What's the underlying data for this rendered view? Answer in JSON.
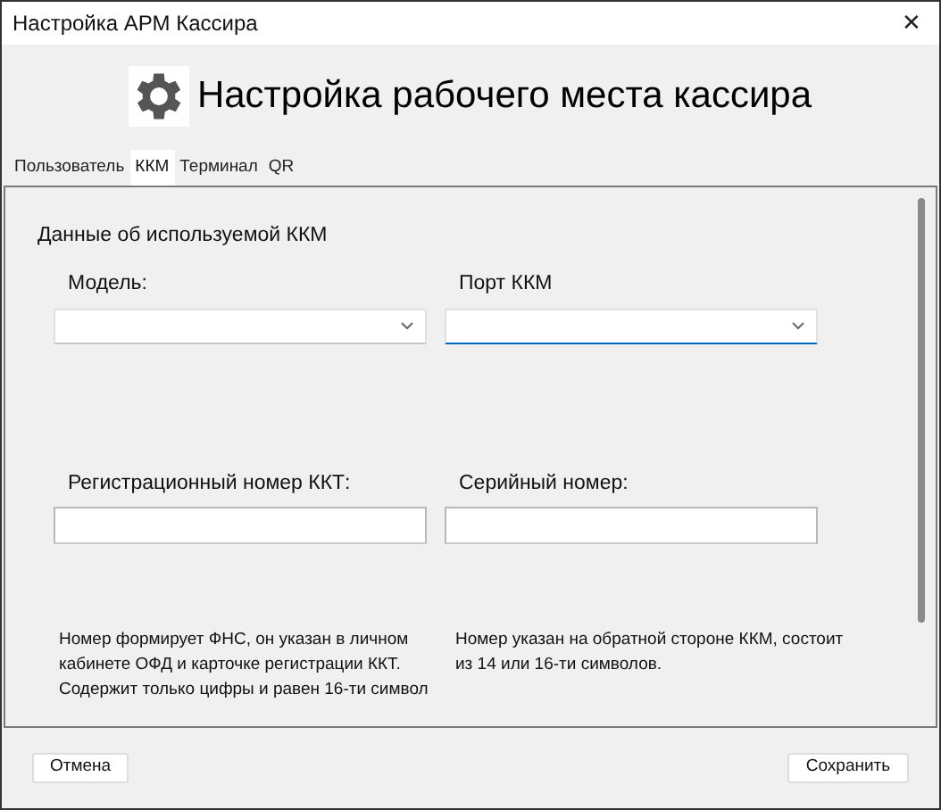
{
  "window": {
    "title": "Настройка АРМ Кассира",
    "close": "✕"
  },
  "header": {
    "title": "Настройка рабочего места кассира"
  },
  "tabs": [
    {
      "label": "Пользователь",
      "selected": false
    },
    {
      "label": "ККМ",
      "selected": true
    },
    {
      "label": "Терминал",
      "selected": false
    },
    {
      "label": "QR",
      "selected": false
    }
  ],
  "section": {
    "title": "Данные об используемой ККМ"
  },
  "fields": [
    {
      "label": "Модель:",
      "kind": "combo",
      "focused": false
    },
    {
      "label": "Порт ККМ",
      "kind": "combo",
      "focused": true
    },
    {
      "label": "Регистрационный номер ККТ:",
      "kind": "text",
      "focused": false,
      "hint": [
        "Номер формирует ФНС, он указан в личном",
        "кабинете ОФД и карточке регистрации ККТ.",
        "Содержит только цифры и равен 16-ти символ"
      ]
    },
    {
      "label": "Серийный номер:",
      "kind": "text",
      "focused": false,
      "hint": [
        "Номер указан на обратной стороне ККМ, состоит",
        "из 14 или 16-ти символов."
      ]
    }
  ],
  "buttons": {
    "cancel": "Отмена",
    "save": "Сохранить"
  }
}
